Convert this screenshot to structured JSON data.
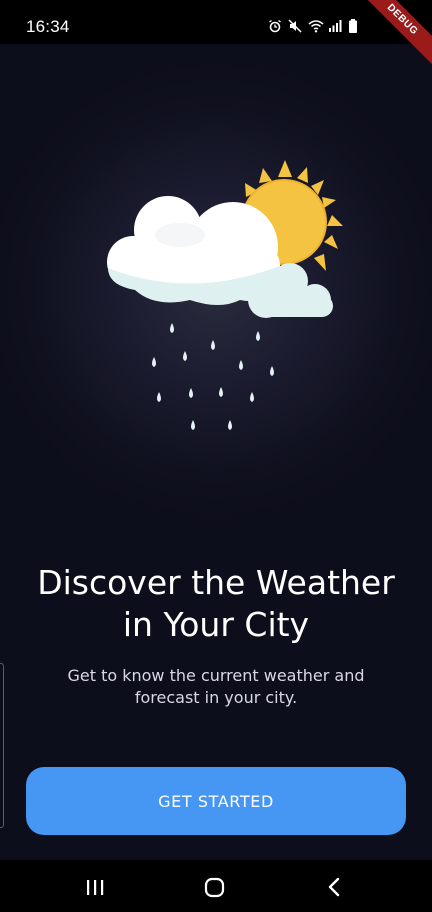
{
  "status_bar": {
    "time": "16:34",
    "icons": [
      "alarm-icon",
      "mute-icon",
      "wifi-icon",
      "signal-icon",
      "battery-icon"
    ]
  },
  "debug_banner": "DEBUG",
  "illustration": {
    "icon": "sun-cloud-rain-icon",
    "colors": {
      "sun": "#f5c342",
      "cloud": "#ffffff",
      "cloud_shadow": "#dff0f0",
      "rain": "#e4f2f6"
    }
  },
  "onboarding": {
    "title_line1": "Discover the Weather",
    "title_line2": "in Your City",
    "subtitle_line1": "Get to know the current weather and",
    "subtitle_line2": "forecast in your city.",
    "cta_label": "GET STARTED"
  },
  "colors": {
    "background": "#0d0e1f",
    "accent": "#4597f3"
  },
  "nav_bar": {
    "buttons": [
      "recent-apps-icon",
      "home-icon",
      "back-icon"
    ]
  }
}
